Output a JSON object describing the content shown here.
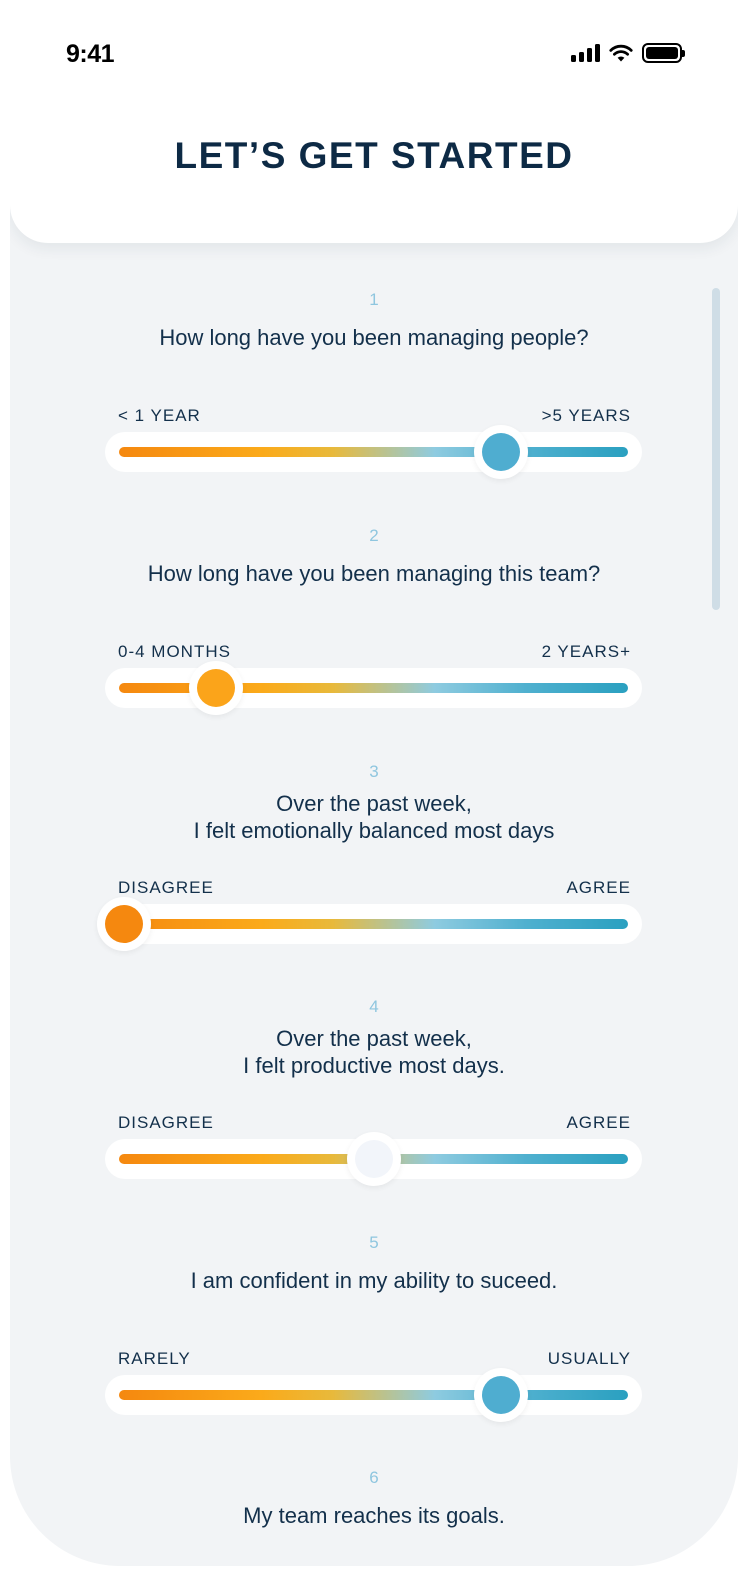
{
  "status_bar": {
    "time": "9:41"
  },
  "header": {
    "title": "LET’S GET STARTED"
  },
  "questions": [
    {
      "number": "1",
      "text": "How long have you been managing people?",
      "min_label": "< 1 YEAR",
      "max_label": ">5 YEARS",
      "value": 0.75,
      "thumb_color": "#4fadd0"
    },
    {
      "number": "2",
      "text": "How long have you been managing this team?",
      "min_label": "0-4 MONTHS",
      "max_label": "2 YEARS+",
      "value": 0.19,
      "thumb_color": "#fba41a"
    },
    {
      "number": "3",
      "text": "Over the past week,\nI felt emotionally balanced most days",
      "min_label": "DISAGREE",
      "max_label": "AGREE",
      "value": 0.0,
      "thumb_color": "#f5880f"
    },
    {
      "number": "4",
      "text": "Over the past week,\nI felt productive most days.",
      "min_label": "DISAGREE",
      "max_label": "AGREE",
      "value": 0.5,
      "thumb_color": "#f2f5fa"
    },
    {
      "number": "5",
      "text": "I am confident in my ability to suceed.",
      "min_label": "RARELY",
      "max_label": "USUALLY",
      "value": 0.75,
      "thumb_color": "#4fadd0"
    },
    {
      "number": "6",
      "text": "My team reaches its goals."
    }
  ],
  "colors": {
    "title": "#0d2a45",
    "text": "#13304b",
    "number": "#8fc6df",
    "background": "#f2f4f6"
  }
}
